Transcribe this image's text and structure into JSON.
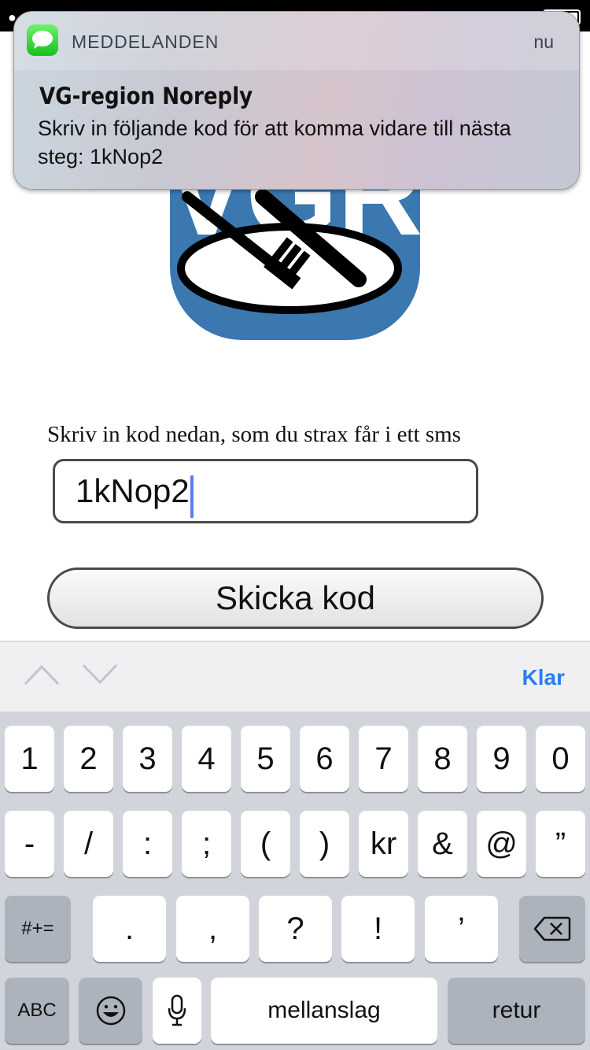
{
  "notification": {
    "app_name": "MEDDELANDEN",
    "time": "nu",
    "sender": "VG-region Noreply",
    "body": "Skriv in följande kod för att komma vidare till nästa steg: 1kNop2"
  },
  "page": {
    "logo_text": "VGR",
    "instruction": "Skriv in kod nedan, som du strax får i ett sms",
    "code_value": "1kNop2",
    "submit_label": "Skicka kod"
  },
  "accessory": {
    "done_label": "Klar"
  },
  "keyboard": {
    "row1": [
      "1",
      "2",
      "3",
      "4",
      "5",
      "6",
      "7",
      "8",
      "9",
      "0"
    ],
    "row2": [
      "-",
      "/",
      ":",
      ";",
      "(",
      ")",
      "kr",
      "&",
      "@",
      "”"
    ],
    "row3": [
      ".",
      ",",
      "?",
      "!",
      "’"
    ],
    "symbols_label": "#+=",
    "abc_label": "ABC",
    "space_label": "mellanslag",
    "return_label": "retur"
  },
  "colors": {
    "accent": "#2a7df2",
    "logo_bg": "#3b78b0",
    "caret": "#5a7cf0"
  }
}
